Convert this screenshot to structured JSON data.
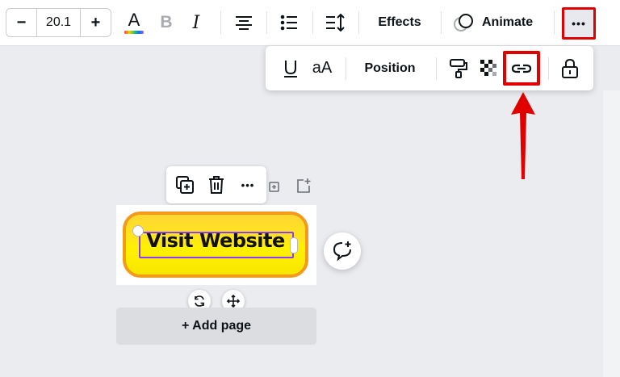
{
  "toolbar": {
    "font_size": "20.1",
    "decrease_label": "−",
    "increase_label": "+",
    "text_color_letter": "A",
    "bold_letter": "B",
    "italic_letter": "I",
    "effects_label": "Effects",
    "animate_label": "Animate",
    "more_label": "•••"
  },
  "popover": {
    "case_label": "aA",
    "position_label": "Position"
  },
  "mini_toolbar": {
    "more_label": "•••"
  },
  "canvas": {
    "banner_text": "Visit Website",
    "add_page_label": "+ Add page"
  },
  "colors": {
    "highlight": "#e10000",
    "selection": "#8b3dff",
    "banner_fill": "#fff200",
    "banner_border": "#f39a1a"
  }
}
